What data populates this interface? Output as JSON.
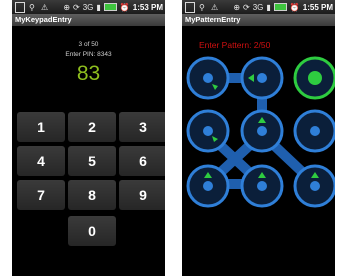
{
  "status_bar": {
    "time": "1:53 PM"
  },
  "status_bar_right": {
    "time": "1:55 PM"
  },
  "keypad_screen": {
    "title": "MyKeypadEntry",
    "counter": "3 of 50",
    "pin_label": "Enter PIN: 8343",
    "entry": "83",
    "keys": [
      "1",
      "2",
      "3",
      "4",
      "5",
      "6",
      "7",
      "8",
      "9",
      "0"
    ]
  },
  "pattern_screen": {
    "title": "MyPatternEntry",
    "prompt": "Enter Pattern: 2/50",
    "colors": {
      "node_blue": "#2f7fd8",
      "node_active": "#2ecc40",
      "connector": "#1f5fae",
      "prompt": "#d01010"
    }
  },
  "icons": [
    "box-icon",
    "usb-icon",
    "warning-icon",
    "gps-icon",
    "sync-icon",
    "3g-icon",
    "signal-icon",
    "battery-icon",
    "alarm-icon"
  ]
}
